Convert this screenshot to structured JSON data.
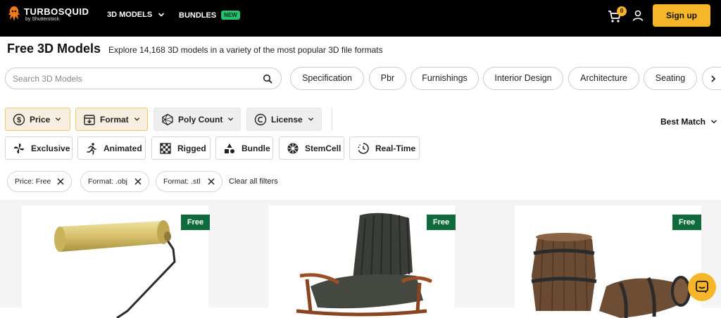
{
  "header": {
    "logo_name": "TURBOSQUID",
    "logo_sub": "by Shutterstock",
    "nav": [
      {
        "label": "3D MODELS"
      },
      {
        "label": "BUNDLES",
        "badge": "NEW"
      }
    ],
    "cart_count": "0",
    "signup_label": "Sign up"
  },
  "page": {
    "title": "Free 3D Models",
    "subtitle": "Explore 14,168 3D models in a variety of the most popular 3D file formats"
  },
  "search": {
    "placeholder": "Search 3D Models"
  },
  "category_pills": [
    {
      "label": "Specification"
    },
    {
      "label": "Pbr"
    },
    {
      "label": "Furnishings"
    },
    {
      "label": "Interior Design"
    },
    {
      "label": "Architecture"
    },
    {
      "label": "Seating"
    }
  ],
  "filters": [
    {
      "label": "Price",
      "icon": "dollar-circle-icon",
      "active": true
    },
    {
      "label": "Format",
      "icon": "download-box-icon",
      "active": true
    },
    {
      "label": "Poly Count",
      "icon": "polygon-icon",
      "active": false
    },
    {
      "label": "License",
      "icon": "copyright-icon",
      "active": false
    }
  ],
  "sort": {
    "label": "Best Match"
  },
  "attributes": [
    {
      "label": "Exclusive",
      "icon": "pinwheel-icon"
    },
    {
      "label": "Animated",
      "icon": "running-person-icon"
    },
    {
      "label": "Rigged",
      "icon": "checkerboard-icon"
    },
    {
      "label": "Bundle",
      "icon": "shapes-icon"
    },
    {
      "label": "StemCell",
      "icon": "stemcell-icon"
    },
    {
      "label": "Real-Time",
      "icon": "realtime-clock-icon"
    }
  ],
  "active_filters": [
    {
      "label": "Price: Free"
    },
    {
      "label": "Format: .obj"
    },
    {
      "label": "Format: .stl"
    }
  ],
  "clear_all_label": "Clear all filters",
  "results": [
    {
      "badge": "Free",
      "subject": "paint-roller"
    },
    {
      "badge": "Free",
      "subject": "rocking-chair"
    },
    {
      "badge": "Free",
      "subject": "wooden-barrels"
    }
  ],
  "colors": {
    "brand_yellow": "#f7b52a",
    "free_badge_green": "#0f6b3b",
    "new_badge_green": "#25c16f",
    "topbar": "#000000"
  }
}
